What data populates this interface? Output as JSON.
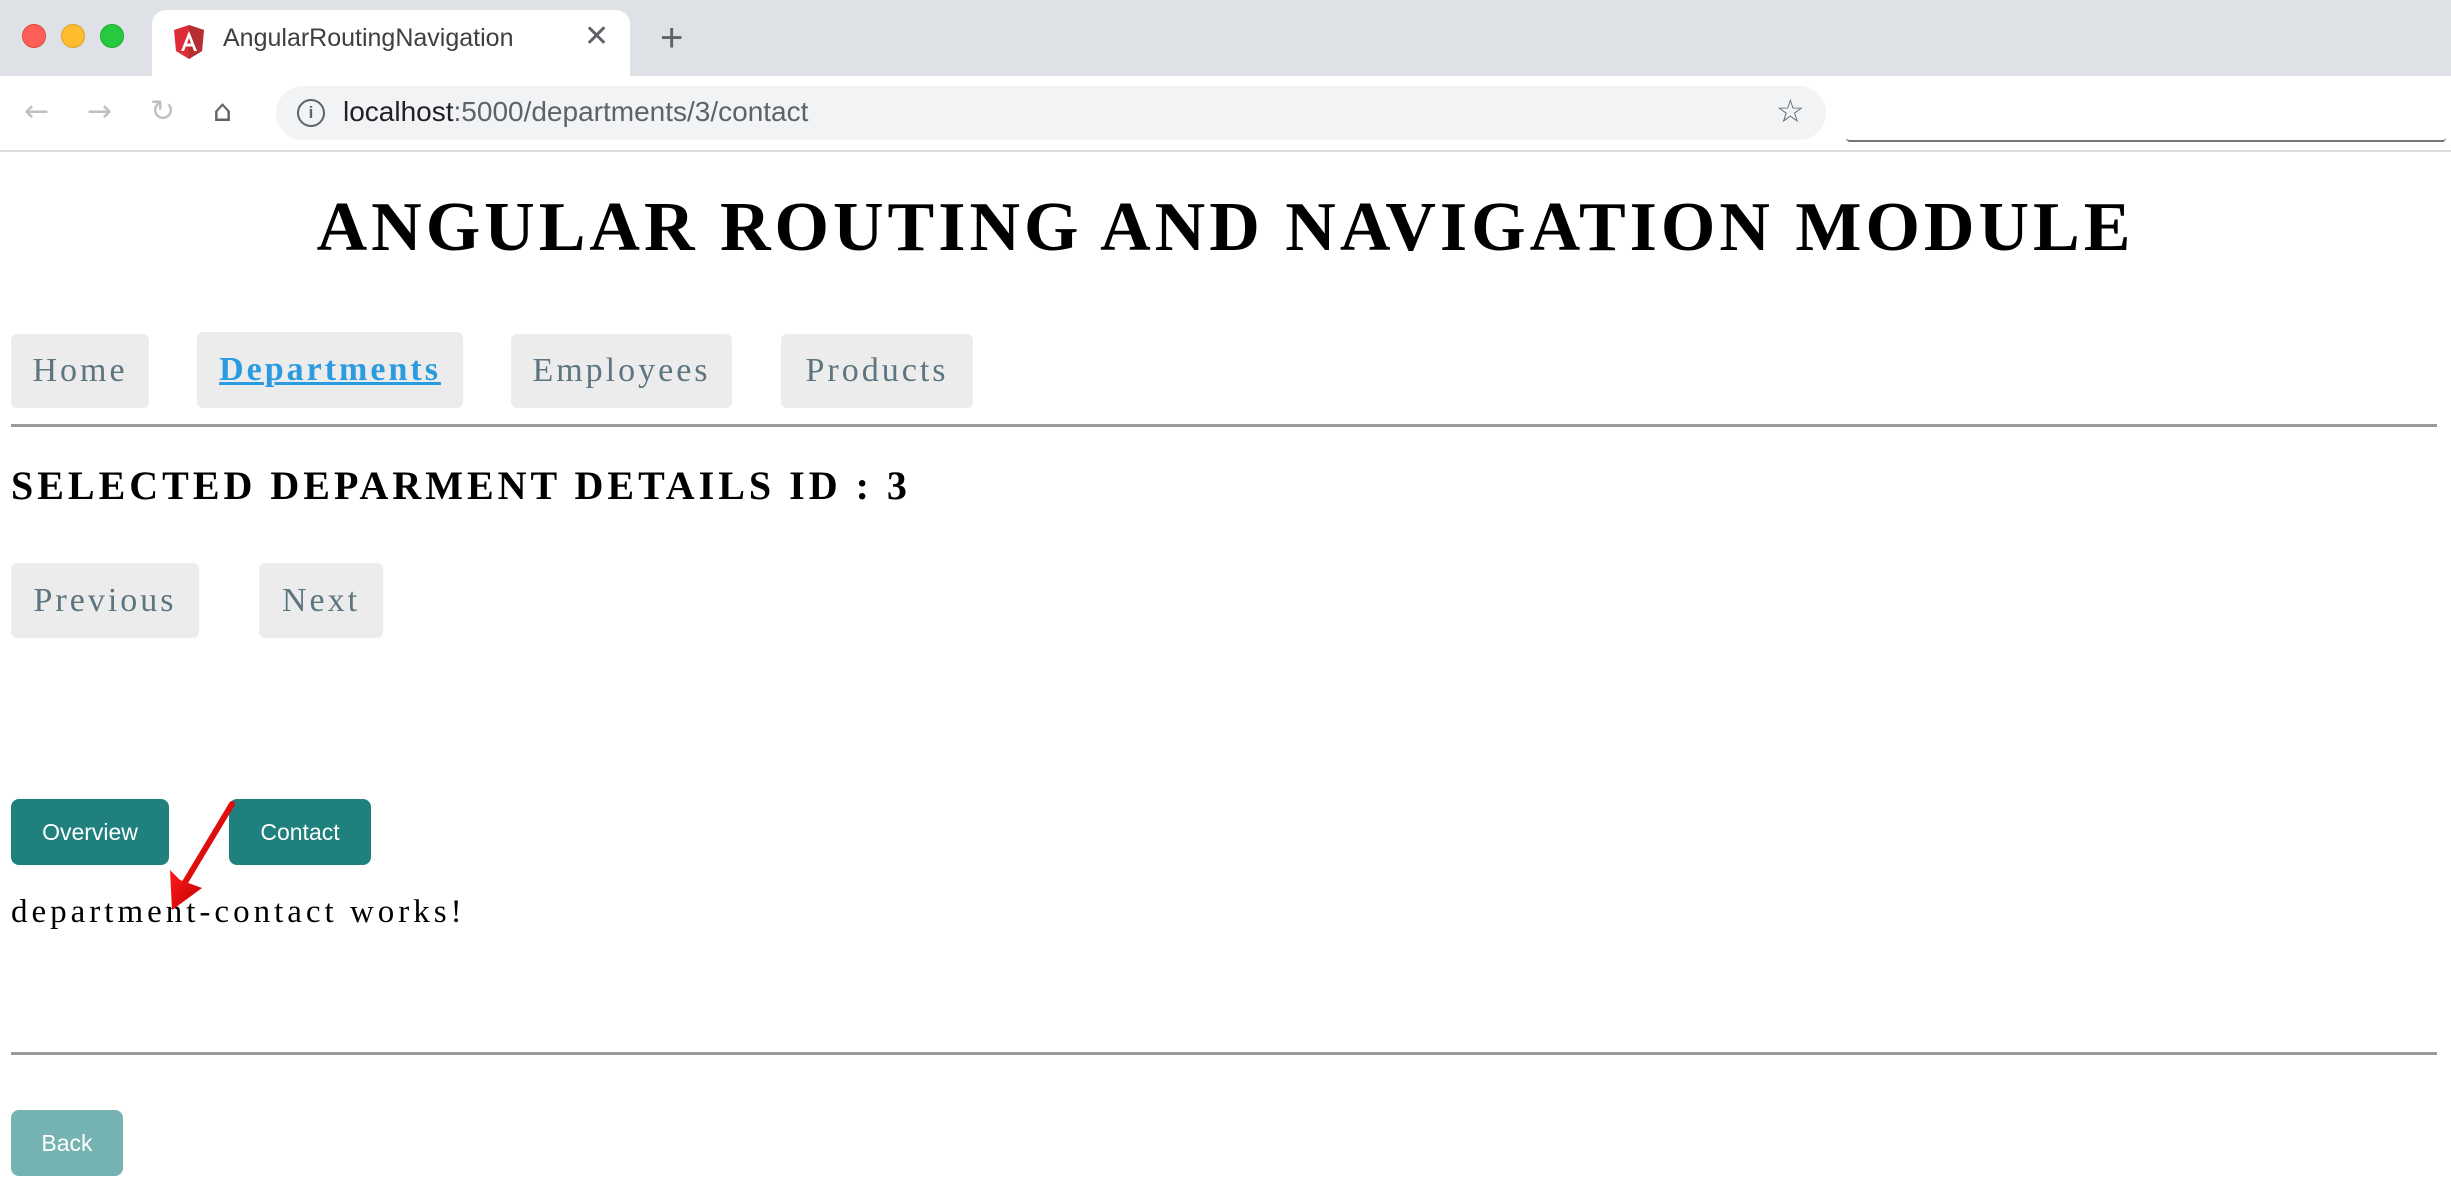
{
  "browser": {
    "tab": {
      "title": "AngularRoutingNavigation",
      "favicon": "angular-logo-icon",
      "close_glyph": "✕"
    },
    "new_tab_glyph": "+",
    "nav": {
      "back_glyph": "←",
      "forward_glyph": "→",
      "reload_glyph": "↻",
      "home_glyph": "⌂"
    },
    "address": {
      "info_glyph": "i",
      "host": "localhost",
      "path": ":5000/departments/3/contact",
      "bookmark_glyph": "☆"
    }
  },
  "page": {
    "title": "ANGULAR ROUTING AND NAVIGATION MODULE",
    "nav": [
      {
        "label": "Home",
        "active": false
      },
      {
        "label": "Departments",
        "active": true
      },
      {
        "label": "Employees",
        "active": false
      },
      {
        "label": "Products",
        "active": false
      }
    ],
    "details_heading": "SELECTED DEPARMENT DETAILS ID : 3",
    "pager": {
      "previous": "Previous",
      "next": "Next"
    },
    "child_routes": {
      "overview": "Overview",
      "contact": "Contact"
    },
    "child_content": "department-contact works!",
    "back_label": "Back"
  },
  "colors": {
    "active_link": "#2a9be0",
    "teal_button": "#1f807d",
    "back_button": "#74b3b1",
    "nav_tab_bg": "#ececec",
    "annotation_arrow": "#e8000b"
  }
}
